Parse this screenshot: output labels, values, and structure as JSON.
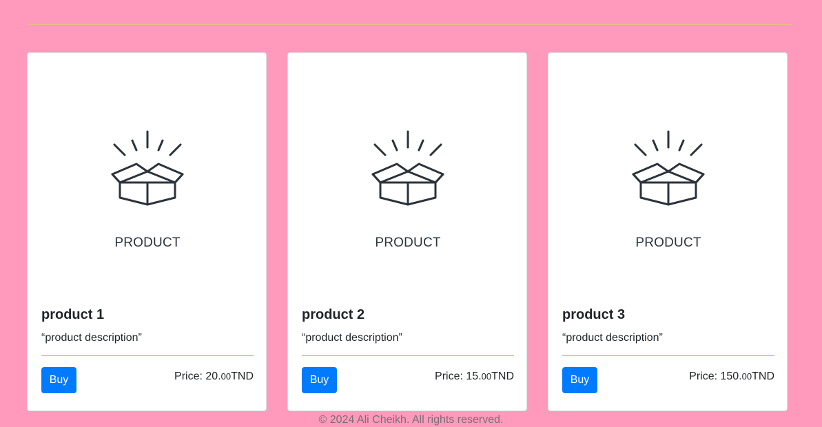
{
  "products": [
    {
      "image_caption": "PRODUCT",
      "title": "product 1",
      "description": "“product description”",
      "buy_label": "Buy",
      "price_prefix": "Price: 20.",
      "price_cents": "00",
      "price_currency": "TND"
    },
    {
      "image_caption": "PRODUCT",
      "title": "product 2",
      "description": "“product description”",
      "buy_label": "Buy",
      "price_prefix": "Price: 15.",
      "price_cents": "00",
      "price_currency": "TND"
    },
    {
      "image_caption": "PRODUCT",
      "title": "product 3",
      "description": "“product description”",
      "buy_label": "Buy",
      "price_prefix": "Price: 150.",
      "price_cents": "00",
      "price_currency": "TND"
    }
  ],
  "footer": {
    "copyright": "© 2024 Ali Cheikh. All rights reserved."
  },
  "colors": {
    "background": "#ff9abc",
    "button": "#007bff",
    "divider": "#d9b46a",
    "icon": "#2b333b"
  },
  "icons": {
    "product_image": "open-box-icon"
  }
}
